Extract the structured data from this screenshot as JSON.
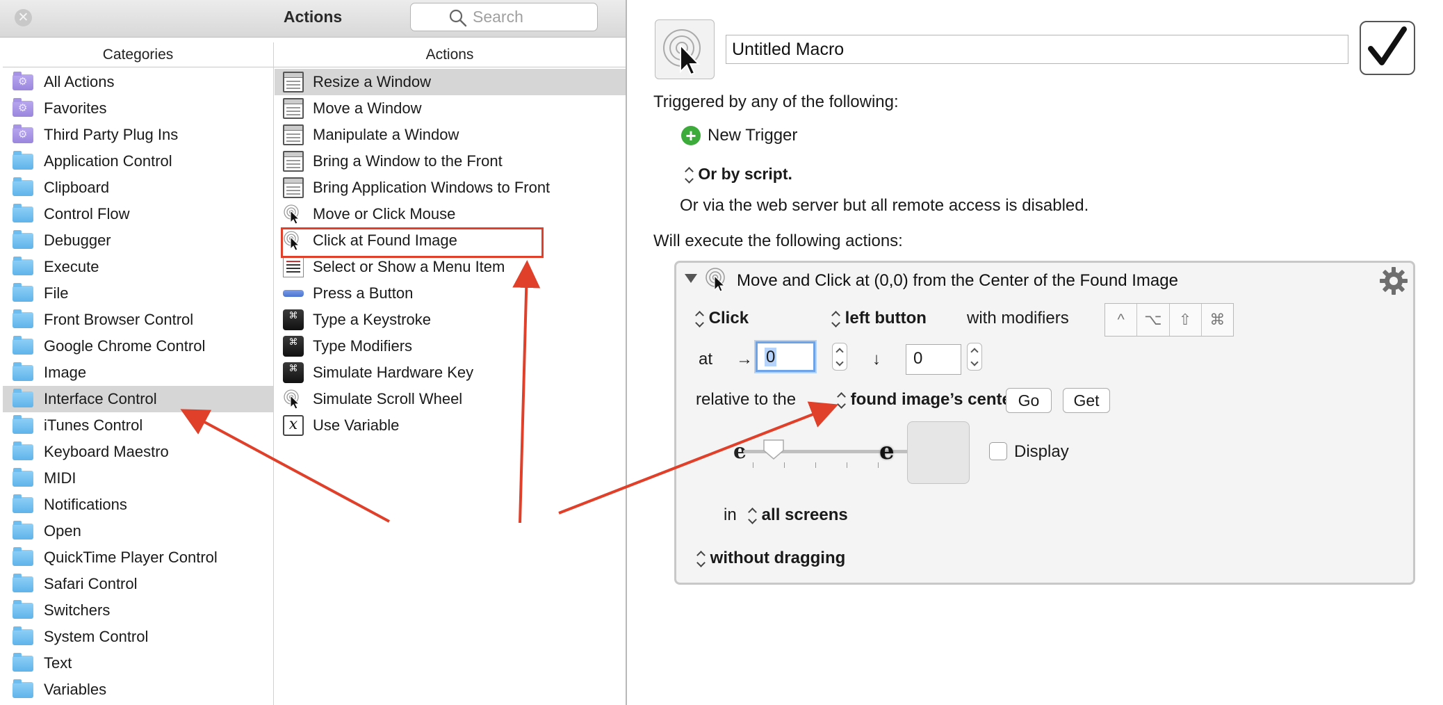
{
  "palette": {
    "title": "Actions",
    "search_placeholder": "Search",
    "categories_header": "Categories",
    "actions_header": "Actions",
    "categories": [
      {
        "label": "All Actions",
        "icon": "purple-gear-folder-icon"
      },
      {
        "label": "Favorites",
        "icon": "purple-gear-folder-icon"
      },
      {
        "label": "Third Party Plug Ins",
        "icon": "purple-gear-folder-icon"
      },
      {
        "label": "Application Control",
        "icon": "folder-icon"
      },
      {
        "label": "Clipboard",
        "icon": "folder-icon"
      },
      {
        "label": "Control Flow",
        "icon": "folder-icon"
      },
      {
        "label": "Debugger",
        "icon": "folder-icon"
      },
      {
        "label": "Execute",
        "icon": "folder-icon"
      },
      {
        "label": "File",
        "icon": "folder-icon"
      },
      {
        "label": "Front Browser Control",
        "icon": "folder-icon"
      },
      {
        "label": "Google Chrome Control",
        "icon": "folder-icon"
      },
      {
        "label": "Image",
        "icon": "folder-icon"
      },
      {
        "label": "Interface Control",
        "icon": "folder-icon",
        "selected": true
      },
      {
        "label": "iTunes Control",
        "icon": "folder-icon"
      },
      {
        "label": "Keyboard Maestro",
        "icon": "folder-icon"
      },
      {
        "label": "MIDI",
        "icon": "folder-icon"
      },
      {
        "label": "Notifications",
        "icon": "folder-icon"
      },
      {
        "label": "Open",
        "icon": "folder-icon"
      },
      {
        "label": "QuickTime Player Control",
        "icon": "folder-icon"
      },
      {
        "label": "Safari Control",
        "icon": "folder-icon"
      },
      {
        "label": "Switchers",
        "icon": "folder-icon"
      },
      {
        "label": "System Control",
        "icon": "folder-icon"
      },
      {
        "label": "Text",
        "icon": "folder-icon"
      },
      {
        "label": "Variables",
        "icon": "folder-icon"
      }
    ],
    "actions": [
      {
        "label": "Resize a Window",
        "icon": "window-icon",
        "selected": true
      },
      {
        "label": "Move a Window",
        "icon": "window-icon"
      },
      {
        "label": "Manipulate a Window",
        "icon": "window-icon"
      },
      {
        "label": "Bring a Window to the Front",
        "icon": "window-icon"
      },
      {
        "label": "Bring Application Windows to Front",
        "icon": "window-icon"
      },
      {
        "label": "Move or Click Mouse",
        "icon": "mouse-click-icon"
      },
      {
        "label": "Click at Found Image",
        "icon": "mouse-click-icon"
      },
      {
        "label": "Select or Show a Menu Item",
        "icon": "menu-icon"
      },
      {
        "label": "Press a Button",
        "icon": "button-icon"
      },
      {
        "label": "Type a Keystroke",
        "icon": "command-key-icon"
      },
      {
        "label": "Type Modifiers",
        "icon": "command-key-icon"
      },
      {
        "label": "Simulate Hardware Key",
        "icon": "command-key-icon"
      },
      {
        "label": "Simulate Scroll Wheel",
        "icon": "mouse-click-icon"
      },
      {
        "label": "Use Variable",
        "icon": "variable-icon"
      }
    ]
  },
  "editor": {
    "macro_name": "Untitled Macro",
    "enabled": true,
    "triggered_label": "Triggered by any of the following:",
    "new_trigger_label": "New Trigger",
    "or_script_label": "Or by script.",
    "web_server_note": "Or via the web server but all remote access is disabled.",
    "will_execute_label": "Will execute the following actions:",
    "action": {
      "title": "Move and Click at (0,0) from the Center of the Found Image",
      "click_type": "Click",
      "mouse_button": "left button",
      "with_modifiers_label": "with modifiers",
      "modifier_keys": [
        "^",
        "⌥",
        "⇧",
        "⌘"
      ],
      "at_label": "at",
      "x_arrow": "→",
      "x_value": "0",
      "y_arrow": "↓",
      "y_value": "0",
      "relative_label": "relative to the",
      "relative_to": "found image’s center",
      "go_label": "Go",
      "get_label": "Get",
      "fuzz_low_glyph": "e",
      "fuzz_high_glyph": "e",
      "display_label": "Display",
      "display_checked": false,
      "in_label": "in",
      "screens": "all screens",
      "drag_mode": "without dragging"
    }
  },
  "colors": {
    "annotation_red": "#e0402a",
    "selection_gray": "#d6d6d6",
    "trigger_green": "#3cab3c"
  }
}
